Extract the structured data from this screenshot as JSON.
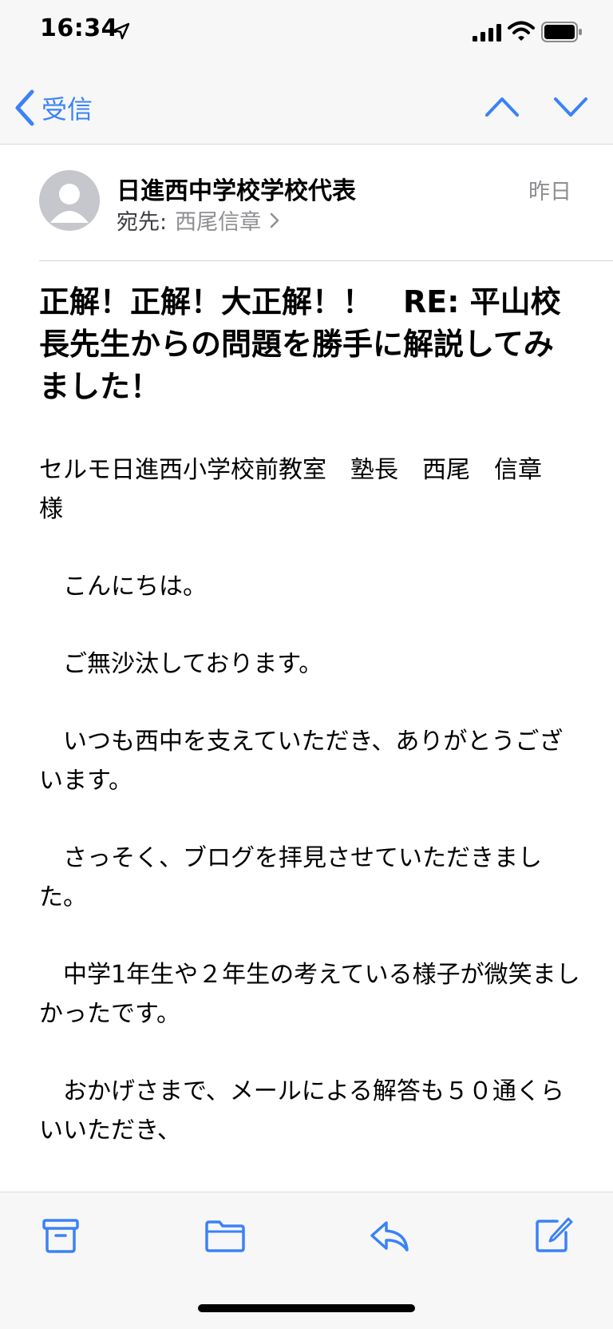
{
  "status_bar": {
    "time": "16:34"
  },
  "nav": {
    "back_label": "受信"
  },
  "email": {
    "sender": "日進西中学校学校代表",
    "date": "昨日",
    "to_label": "宛先:",
    "to_name": "西尾信章",
    "subject": "正解！正解！大正解！！　RE: 平山校長先生からの問題を勝手に解説してみました！",
    "body": [
      "セルモ日進西小学校前教室　塾長　西尾　信章　様",
      "　こんにちは。",
      "　ご無沙汰しております。",
      "　いつも西中を支えていただき、ありがとうございます。",
      "　さっそく、ブログを拝見させていただきました。",
      "　中学1年生や２年生の考えている様子が微笑ましかったです。",
      "　おかげさまで、メールによる解答も５０通くらいいただき、"
    ]
  },
  "colors": {
    "accent": "#3a82f7",
    "secondary_text": "#8e8e93",
    "bar_bg": "#f7f7f7"
  },
  "icons": [
    "location-arrow-icon",
    "signal-icon",
    "wifi-icon",
    "battery-icon",
    "chevron-left-icon",
    "chevron-up-icon",
    "chevron-down-icon",
    "chevron-right-icon",
    "avatar-icon",
    "archive-icon",
    "folder-icon",
    "reply-icon",
    "compose-icon"
  ]
}
